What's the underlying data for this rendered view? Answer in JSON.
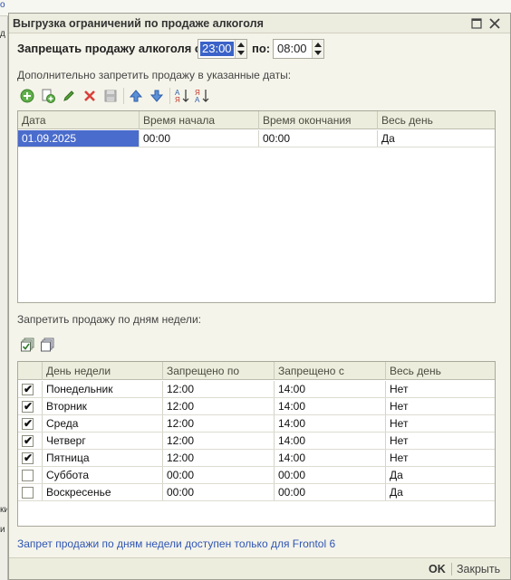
{
  "background": {
    "link_fragment": "о",
    "glyph_1": "д",
    "glyph_2": "ки",
    "glyph_3": "и"
  },
  "window": {
    "title": "Выгрузка ограничений по продаже алкоголя",
    "colors": {
      "accent": "#3a62c8",
      "link": "#2f55b4",
      "header_bg": "#eceddc"
    }
  },
  "time_range": {
    "label_from": "Запрещать продажу алкоголя с:",
    "from_value": "23:00",
    "label_to": "по:",
    "to_value": "08:00"
  },
  "dates_section": {
    "label": "Дополнительно запретить продажу в указанные даты:",
    "toolbar": [
      "add-icon",
      "copy-add-icon",
      "edit-pencil-icon",
      "delete-icon",
      "save-disk-icon",
      "move-up-icon",
      "move-down-icon",
      "sort-asc-icon",
      "sort-desc-icon"
    ],
    "columns": [
      "Дата",
      "Время начала",
      "Время окончания",
      "Весь день"
    ],
    "rows": [
      [
        "01.09.2025",
        "00:00",
        "00:00",
        "Да"
      ]
    ]
  },
  "weekdays_section": {
    "label": "Запретить продажу по дням недели:",
    "toolbar": [
      "check-all-icon",
      "uncheck-all-icon"
    ],
    "columns": [
      "",
      "День недели",
      "Запрещено по",
      "Запрещено с",
      "Весь день"
    ],
    "rows": [
      {
        "checked": true,
        "day": "Понедельник",
        "to": "12:00",
        "from": "14:00",
        "all_day": "Нет"
      },
      {
        "checked": true,
        "day": "Вторник",
        "to": "12:00",
        "from": "14:00",
        "all_day": "Нет"
      },
      {
        "checked": true,
        "day": "Среда",
        "to": "12:00",
        "from": "14:00",
        "all_day": "Нет"
      },
      {
        "checked": true,
        "day": "Четверг",
        "to": "12:00",
        "from": "14:00",
        "all_day": "Нет"
      },
      {
        "checked": true,
        "day": "Пятница",
        "to": "12:00",
        "from": "14:00",
        "all_day": "Нет"
      },
      {
        "checked": false,
        "day": "Суббота",
        "to": "00:00",
        "from": "00:00",
        "all_day": "Да"
      },
      {
        "checked": false,
        "day": "Воскресенье",
        "to": "00:00",
        "from": "00:00",
        "all_day": "Да"
      }
    ],
    "note": "Запрет продажи по дням недели доступен только для Frontol 6"
  },
  "footer": {
    "ok_label": "OK",
    "cancel_label": "Закрыть"
  }
}
